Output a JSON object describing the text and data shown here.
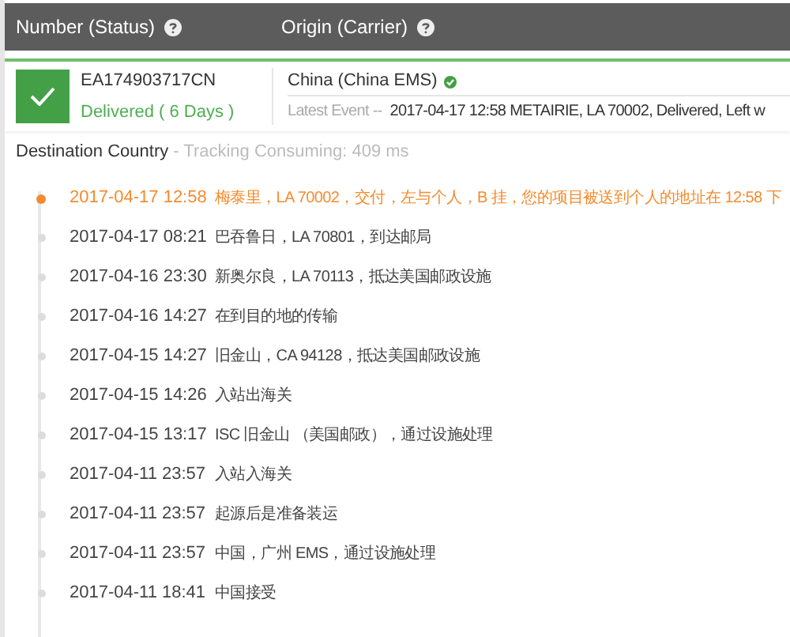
{
  "header": {
    "columns": [
      {
        "label": "Number (Status)"
      },
      {
        "label": "Origin (Carrier)"
      }
    ]
  },
  "package": {
    "number": "EA174903717CN",
    "status": "Delivered ( 6 Days )",
    "delivered": true,
    "origin": "China (China EMS)",
    "origin_verified": true,
    "latest_label": "Latest Event --",
    "latest_event": "2017-04-17 12:58 METAIRIE, LA 70002, Delivered, Left w"
  },
  "destination": {
    "title": "Destination Country",
    "info": "- Tracking Consuming: 409 ms"
  },
  "events": [
    {
      "time": "2017-04-17 12:58",
      "text": "梅泰里，LA 70002，交付，左与个人，B 挂，您的项目被送到个人的地址在 12:58 下",
      "current": true
    },
    {
      "time": "2017-04-17 08:21",
      "text": "巴吞鲁日，LA 70801，到达邮局",
      "current": false
    },
    {
      "time": "2017-04-16 23:30",
      "text": "新奥尔良，LA 70113，抵达美国邮政设施",
      "current": false
    },
    {
      "time": "2017-04-16 14:27",
      "text": "在到目的地的传输",
      "current": false
    },
    {
      "time": "2017-04-15 14:27",
      "text": "旧金山，CA 94128，抵达美国邮政设施",
      "current": false
    },
    {
      "time": "2017-04-15 14:26",
      "text": "入站出海关",
      "current": false
    },
    {
      "time": "2017-04-15 13:17",
      "text": "ISC 旧金山 （美国邮政），通过设施处理",
      "current": false
    },
    {
      "time": "2017-04-11 23:57",
      "text": "入站入海关",
      "current": false
    },
    {
      "time": "2017-04-11 23:57",
      "text": "起源后是准备装运",
      "current": false
    },
    {
      "time": "2017-04-11 23:57",
      "text": "中国，广州 EMS，通过设施处理",
      "current": false
    },
    {
      "time": "2017-04-11 18:41",
      "text": "中国接受",
      "current": false
    }
  ]
}
